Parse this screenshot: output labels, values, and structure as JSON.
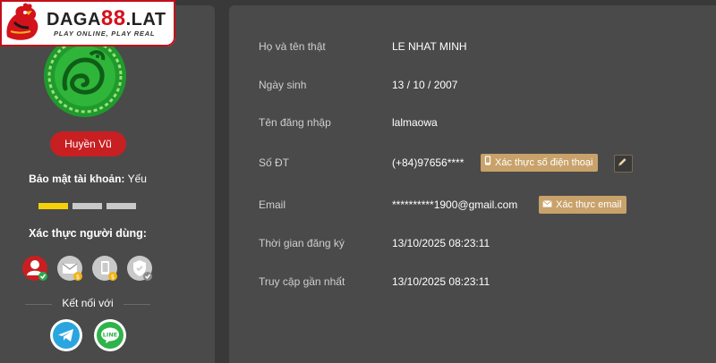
{
  "logo": {
    "brand_prefix": "DAGA",
    "brand_number": "88",
    "brand_suffix": ".LAT",
    "tagline": "PLAY ONLINE, PLAY REAL",
    "colors": {
      "red": "#d3121c",
      "dark": "#222222"
    }
  },
  "sidebar": {
    "rank_label": "Huyền Vũ",
    "security_label": "Bảo mật tài khoản:",
    "security_value": "Yếu",
    "security_level": 1,
    "security_levels_total": 3,
    "verify_title": "Xác thực người dùng:",
    "verify_icons": [
      "user-icon",
      "email-icon",
      "phone-icon",
      "shield-icon"
    ],
    "connect_label": "Kết nối với",
    "social": [
      "telegram-icon",
      "line-icon"
    ]
  },
  "profile": {
    "rows": [
      {
        "label": "Họ và tên thật",
        "value": "LE NHAT MINH"
      },
      {
        "label": "Ngày sinh",
        "value": "13 / 10 / 2007"
      },
      {
        "label": "Tên đăng nhập",
        "value": "lalmaowa"
      },
      {
        "label": "Số ĐT",
        "value": "(+84)97656****"
      },
      {
        "label": "Email",
        "value": "**********1900@gmail.com"
      },
      {
        "label": "Thời gian đăng ký",
        "value": "13/10/2025 08:23:11"
      },
      {
        "label": "Truy cập gần nhất",
        "value": "13/10/2025 08:23:11"
      }
    ],
    "phone_verify_label": "Xác thực số điện thoại",
    "email_verify_label": "Xác thực email"
  },
  "colors": {
    "background": "#393939",
    "panel": "#4a4a4a",
    "accent_gold": "#c8a26a",
    "rank_red": "#c81f22",
    "security_active": "#f5d10a",
    "security_inactive": "#c9c9c9"
  }
}
